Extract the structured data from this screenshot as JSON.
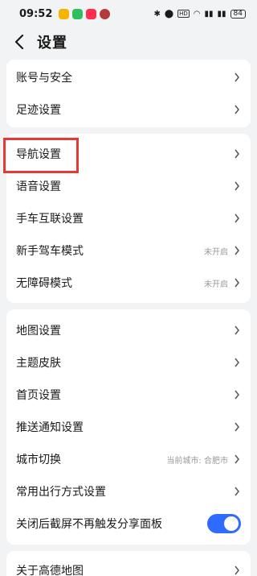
{
  "status": {
    "time": "09:52",
    "battery": "84",
    "apps": [
      {
        "icon": "weibo-icon",
        "color": "#f5b400"
      },
      {
        "icon": "chat-app-icon",
        "color": "#2fbf5f"
      },
      {
        "icon": "xiaohongshu-icon",
        "color": "#ff2e4d"
      },
      {
        "icon": "app-icon",
        "color": "#b33b3b"
      }
    ]
  },
  "header": {
    "title": "设置"
  },
  "groups": {
    "account": [
      {
        "label": "账号与安全"
      },
      {
        "label": "足迹设置"
      }
    ],
    "nav": [
      {
        "label": "导航设置"
      },
      {
        "label": "语音设置"
      },
      {
        "label": "手车互联设置"
      },
      {
        "label": "新手驾车模式",
        "value": "未开启"
      },
      {
        "label": "无障碍模式",
        "value": "未开启"
      }
    ],
    "general": [
      {
        "label": "地图设置"
      },
      {
        "label": "主题皮肤"
      },
      {
        "label": "首页设置"
      },
      {
        "label": "推送通知设置"
      },
      {
        "label": "城市切换",
        "value": "当前城市: 合肥市"
      },
      {
        "label": "常用出行方式设置"
      },
      {
        "label": "关闭后截屏不再触发分享面板",
        "toggle_on": true
      }
    ],
    "about": [
      {
        "label": "关于高德地图"
      }
    ]
  },
  "colors": {
    "accent": "#2f6bff",
    "highlight": "#e53935"
  }
}
